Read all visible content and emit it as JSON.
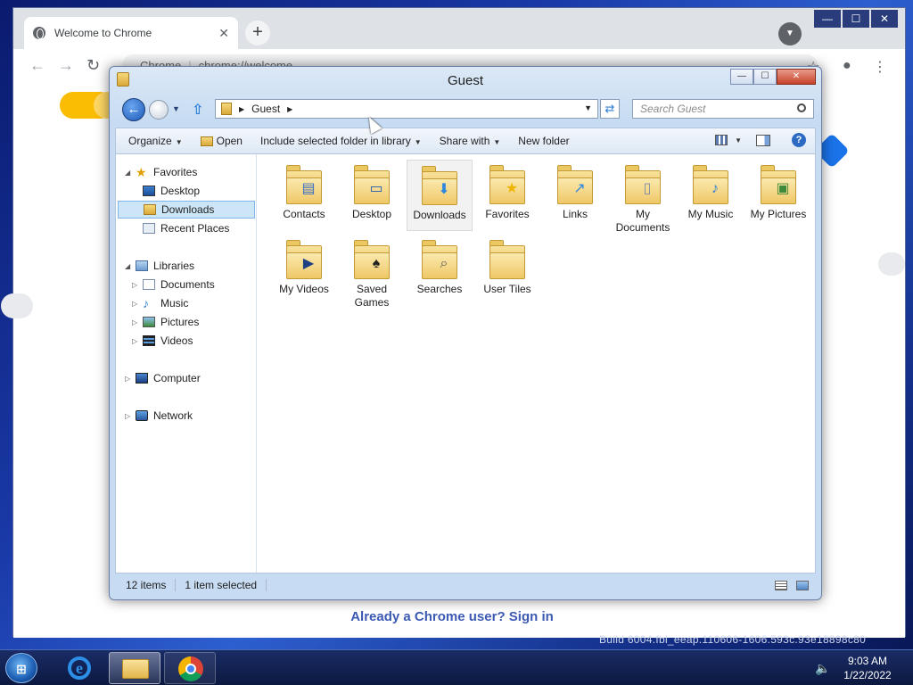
{
  "chrome": {
    "tab_title": "Welcome to Chrome",
    "tab_close": "✕",
    "new_tab": "+",
    "window_buttons": [
      "—",
      "☐",
      "✕"
    ],
    "omnibox_label": "Chrome",
    "omnibox_url": "chrome://welcome",
    "signin_text": "Already a Chrome user? Sign in"
  },
  "build_text": "Build 6004.fbl_eeap.110606-1606.593c.93e18898c80",
  "explorer": {
    "title": "Guest",
    "caption_buttons": {
      "minimize": "—",
      "maximize": "☐",
      "close": "✕"
    },
    "address": {
      "crumbs": [
        "Guest"
      ]
    },
    "search_placeholder": "Search Guest",
    "commands": {
      "organize": "Organize",
      "open": "Open",
      "include": "Include selected folder in library",
      "share": "Share with",
      "new_folder": "New folder",
      "help": "?"
    },
    "nav": {
      "favorites": "Favorites",
      "desktop": "Desktop",
      "downloads": "Downloads",
      "recent": "Recent Places",
      "libraries": "Libraries",
      "documents": "Documents",
      "music": "Music",
      "pictures": "Pictures",
      "videos": "Videos",
      "computer": "Computer",
      "network": "Network"
    },
    "files": [
      {
        "line1": "Contacts",
        "line2": "",
        "badge": "▤",
        "badge_color": "#3a6ec2"
      },
      {
        "line1": "Desktop",
        "line2": "",
        "badge": "▭",
        "badge_color": "#1f5bb0"
      },
      {
        "line1": "Downloads",
        "line2": "",
        "badge": "⬇",
        "badge_color": "#2a86e0"
      },
      {
        "line1": "Favorites",
        "line2": "",
        "badge": "★",
        "badge_color": "#f0b400"
      },
      {
        "line1": "Links",
        "line2": "",
        "badge": "↗",
        "badge_color": "#2a86e0"
      },
      {
        "line1": "My",
        "line2": "Documents",
        "badge": "▯",
        "badge_color": "#7a8ca8"
      },
      {
        "line1": "My Music",
        "line2": "",
        "badge": "♪",
        "badge_color": "#2a7fd6"
      },
      {
        "line1": "My Pictures",
        "line2": "",
        "badge": "▣",
        "badge_color": "#3f8a3a"
      },
      {
        "line1": "My Videos",
        "line2": "",
        "badge": "▶",
        "badge_color": "#1f3f82"
      },
      {
        "line1": "Saved",
        "line2": "Games",
        "badge": "♠",
        "badge_color": "#222222"
      },
      {
        "line1": "Searches",
        "line2": "",
        "badge": "⌕",
        "badge_color": "#555555"
      },
      {
        "line1": "User Tiles",
        "line2": "",
        "badge": "",
        "badge_color": "#e2b64c"
      }
    ],
    "status": {
      "items": "12 items",
      "selected": "1 item selected"
    }
  },
  "taskbar": {
    "clock_time": "9:03 AM",
    "clock_date": "1/22/2022",
    "volume": "🔈"
  }
}
